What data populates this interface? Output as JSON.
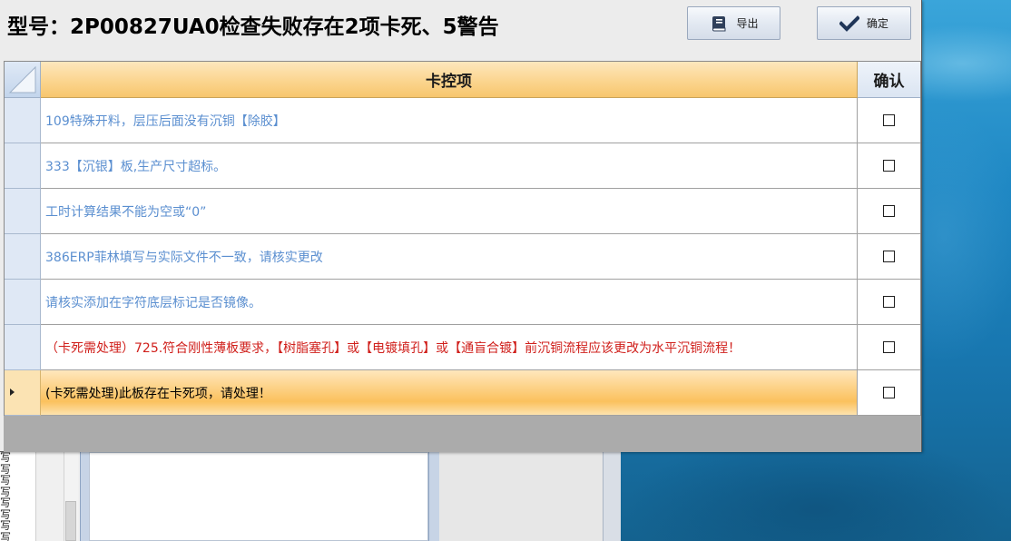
{
  "dialog": {
    "title": "型号：2P00827UA0检查失败存在2项卡死、5警告",
    "export_button": {
      "label": "导出",
      "icon": "book-icon"
    },
    "ok_button": {
      "label": "确定",
      "icon": "checkmark-icon"
    }
  },
  "grid": {
    "columns": {
      "item": "卡控项",
      "confirm": "确认"
    },
    "rows": [
      {
        "text": "109特殊开料，层压后面没有沉铜【除胶】",
        "level": "warning",
        "color": "#5b8fd0",
        "checked": false,
        "selected": false
      },
      {
        "text": "333【沉银】板,生产尺寸超标。",
        "level": "warning",
        "color": "#5b8fd0",
        "checked": false,
        "selected": false
      },
      {
        "text": "工时计算结果不能为空或“0”",
        "level": "warning",
        "color": "#5b8fd0",
        "checked": false,
        "selected": false
      },
      {
        "text": "386ERP菲林填写与实际文件不一致，请核实更改",
        "level": "warning",
        "color": "#5b8fd0",
        "checked": false,
        "selected": false
      },
      {
        "text": "请核实添加在字符底层标记是否镜像。",
        "level": "warning",
        "color": "#5b8fd0",
        "checked": false,
        "selected": false
      },
      {
        "text": "（卡死需处理）725.符合刚性薄板要求，【树脂塞孔】或【电镀填孔】或【通盲合镀】前沉铜流程应该更改为水平沉铜流程！",
        "level": "blocking",
        "color": "#d0201c",
        "checked": false,
        "selected": false
      },
      {
        "text": "(卡死需处理)此板存在卡死项，请处理！",
        "level": "blocking",
        "color": "#000000",
        "checked": false,
        "selected": true
      }
    ]
  },
  "background_app": {
    "left_list": [
      "写",
      "写",
      "写",
      "写",
      "写",
      "写",
      "写",
      "写"
    ]
  },
  "colors": {
    "header_gradient": "#fbd58f",
    "selected_row": "#fbc15d",
    "warning_text": "#5b8fd0",
    "blocking_text": "#d0201c"
  }
}
